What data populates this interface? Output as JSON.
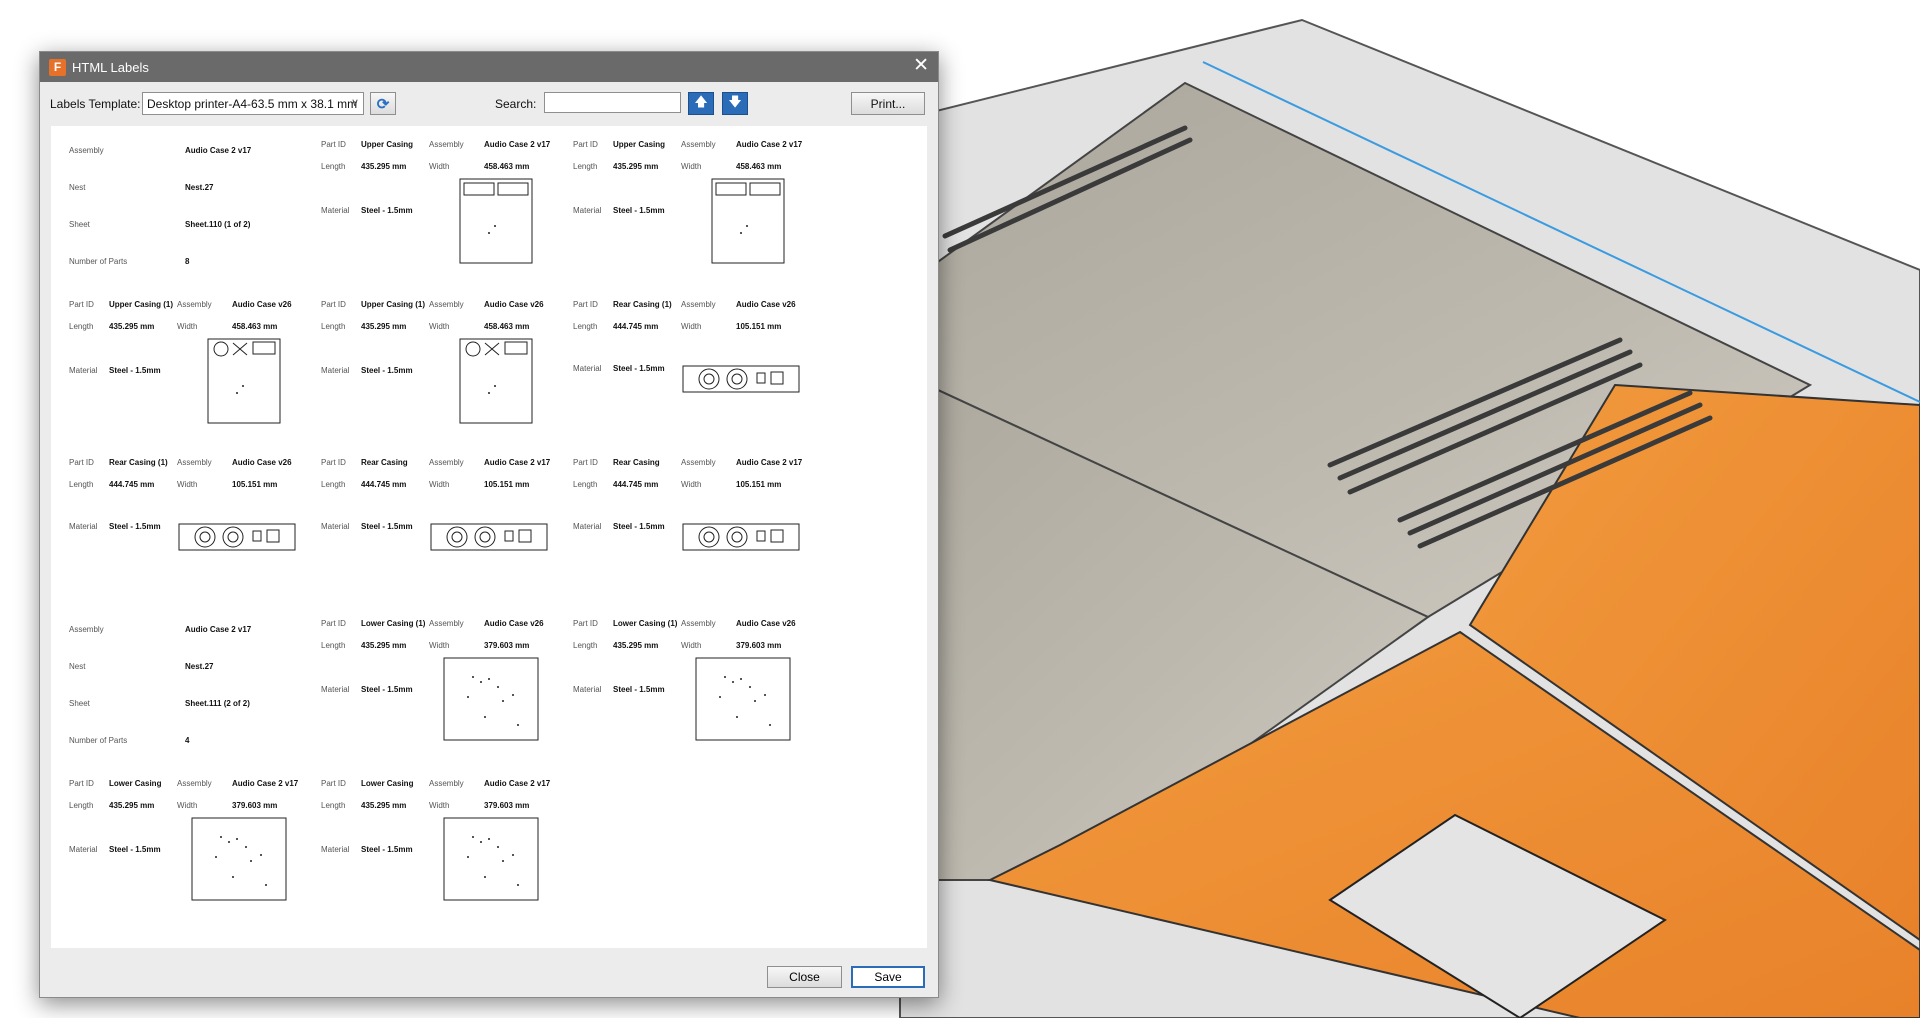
{
  "dialog": {
    "title": "HTML Labels",
    "app_icon_letter": "F",
    "close_glyph": "✕",
    "template_label": "Labels Template:",
    "template_value": "Desktop printer-A4-63.5 mm x 38.1 mm",
    "search_label": "Search:",
    "search_value": "",
    "print_label": "Print...",
    "close_label": "Close",
    "save_label": "Save"
  },
  "colors": {
    "sheet_gray": "#b4b0a6",
    "part_orange": "#ef8f2f",
    "bed": "#dedede",
    "accent_blue": "#2b6cb8"
  },
  "labels": [
    {
      "kind": "sheet",
      "assembly_key": "Assembly",
      "assembly": "Audio Case 2 v17",
      "nest_key": "Nest",
      "nest": "Nest.27",
      "sheet_key": "Sheet",
      "sheet": "Sheet.110 (1 of 2)",
      "parts_key": "Number of Parts",
      "parts": "8"
    },
    {
      "kind": "part",
      "shape": "upper",
      "partid_key": "Part ID",
      "partid": "Upper Casing",
      "assembly_key": "Assembly",
      "assembly": "Audio Case 2 v17",
      "length_key": "Length",
      "length": "435.295 mm",
      "width_key": "Width",
      "width": "458.463 mm",
      "material_key": "Material",
      "material": "Steel - 1.5mm"
    },
    {
      "kind": "part",
      "shape": "upper",
      "partid_key": "Part ID",
      "partid": "Upper Casing",
      "assembly_key": "Assembly",
      "assembly": "Audio Case 2 v17",
      "length_key": "Length",
      "length": "435.295 mm",
      "width_key": "Width",
      "width": "458.463 mm",
      "material_key": "Material",
      "material": "Steel - 1.5mm"
    },
    {
      "kind": "part",
      "shape": "upper2",
      "partid_key": "Part ID",
      "partid": "Upper Casing (1)",
      "assembly_key": "Assembly",
      "assembly": "Audio Case v26",
      "length_key": "Length",
      "length": "435.295 mm",
      "width_key": "Width",
      "width": "458.463 mm",
      "material_key": "Material",
      "material": "Steel - 1.5mm"
    },
    {
      "kind": "part",
      "shape": "upper2",
      "partid_key": "Part ID",
      "partid": "Upper Casing (1)",
      "assembly_key": "Assembly",
      "assembly": "Audio Case v26",
      "length_key": "Length",
      "length": "435.295 mm",
      "width_key": "Width",
      "width": "458.463 mm",
      "material_key": "Material",
      "material": "Steel - 1.5mm"
    },
    {
      "kind": "part",
      "shape": "rear",
      "partid_key": "Part ID",
      "partid": "Rear Casing (1)",
      "assembly_key": "Assembly",
      "assembly": "Audio Case v26",
      "length_key": "Length",
      "length": "444.745 mm",
      "width_key": "Width",
      "width": "105.151 mm",
      "material_key": "Material",
      "material": "Steel - 1.5mm"
    },
    {
      "kind": "part",
      "shape": "rear",
      "partid_key": "Part ID",
      "partid": "Rear Casing (1)",
      "assembly_key": "Assembly",
      "assembly": "Audio Case v26",
      "length_key": "Length",
      "length": "444.745 mm",
      "width_key": "Width",
      "width": "105.151 mm",
      "material_key": "Material",
      "material": "Steel - 1.5mm"
    },
    {
      "kind": "part",
      "shape": "rear",
      "partid_key": "Part ID",
      "partid": "Rear Casing",
      "assembly_key": "Assembly",
      "assembly": "Audio Case 2 v17",
      "length_key": "Length",
      "length": "444.745 mm",
      "width_key": "Width",
      "width": "105.151 mm",
      "material_key": "Material",
      "material": "Steel - 1.5mm"
    },
    {
      "kind": "part",
      "shape": "rear",
      "partid_key": "Part ID",
      "partid": "Rear Casing",
      "assembly_key": "Assembly",
      "assembly": "Audio Case 2 v17",
      "length_key": "Length",
      "length": "444.745 mm",
      "width_key": "Width",
      "width": "105.151 mm",
      "material_key": "Material",
      "material": "Steel - 1.5mm"
    },
    {
      "kind": "sheet",
      "assembly_key": "Assembly",
      "assembly": "Audio Case 2 v17",
      "nest_key": "Nest",
      "nest": "Nest.27",
      "sheet_key": "Sheet",
      "sheet": "Sheet.111 (2 of 2)",
      "parts_key": "Number of Parts",
      "parts": "4"
    },
    {
      "kind": "part",
      "shape": "lower",
      "partid_key": "Part ID",
      "partid": "Lower Casing (1)",
      "assembly_key": "Assembly",
      "assembly": "Audio Case v26",
      "length_key": "Length",
      "length": "435.295 mm",
      "width_key": "Width",
      "width": "379.603 mm",
      "material_key": "Material",
      "material": "Steel - 1.5mm"
    },
    {
      "kind": "part",
      "shape": "lower",
      "partid_key": "Part ID",
      "partid": "Lower Casing (1)",
      "assembly_key": "Assembly",
      "assembly": "Audio Case v26",
      "length_key": "Length",
      "length": "435.295 mm",
      "width_key": "Width",
      "width": "379.603 mm",
      "material_key": "Material",
      "material": "Steel - 1.5mm"
    },
    {
      "kind": "part",
      "shape": "lower",
      "partid_key": "Part ID",
      "partid": "Lower Casing",
      "assembly_key": "Assembly",
      "assembly": "Audio Case 2 v17",
      "length_key": "Length",
      "length": "435.295 mm",
      "width_key": "Width",
      "width": "379.603 mm",
      "material_key": "Material",
      "material": "Steel - 1.5mm"
    },
    {
      "kind": "part",
      "shape": "lower",
      "partid_key": "Part ID",
      "partid": "Lower Casing",
      "assembly_key": "Assembly",
      "assembly": "Audio Case 2 v17",
      "length_key": "Length",
      "length": "435.295 mm",
      "width_key": "Width",
      "width": "379.603 mm",
      "material_key": "Material",
      "material": "Steel - 1.5mm"
    }
  ]
}
